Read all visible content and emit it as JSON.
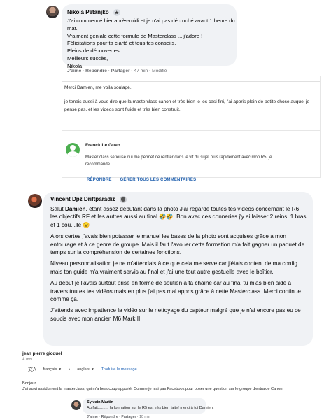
{
  "comment1": {
    "author": "Nikola Petanjko",
    "lines": [
      "J'ai commencé hier après-midi et je n'ai pas décroché avant 1 heure du mat.",
      "Vraiment géniale cette formule de Masterclass ... j'adore !",
      "Félicitations pour ta clarté et tous tes conseils.",
      "Pleins de découvertes.",
      "Meilleurs succès,",
      "Nikola"
    ],
    "like": "J'aime",
    "reply": "Répondre",
    "share": "Partager",
    "time": "47 min",
    "edited": "Modifié"
  },
  "reply_box": {
    "line1": "Merci Damien, me voila soulagé.",
    "para2": "je tenais aussi à vous dire que la masterclass canon et très bien je les casi fini, j'ai appris plein de petite chose auquel je pensé pas, et les videos sont fluide et très bien construit.",
    "sub_author": "Franck Le Guen",
    "sub_text": "Master class sérieuse qui me permet de rentrer dans le vif du sujet plus rapidement avec mon R5, je recommande.",
    "link_reply": "RÉPONDRE",
    "link_manage": "GÉRER TOUS LES COMMENTAIRES"
  },
  "comment2": {
    "author": "Vincent Dpz Driftparadiz",
    "p1_start": "Salut ",
    "p1_name": "Damien",
    "p1_rest": ", étant assez débutant dans la photo J'ai regardé toutes tes vidéos concernant le R6, les objectifs RF et les autres aussi au final 🤣🤣. Bon avec ces conneries j'y ai laisser 2 reins, 1 bras et 1 cou...lle 😉",
    "p2": "Alors certes j'avais bien potasser le manuel les bases de la photo sont acquises grâce a mon entourage et à ce genre de groupe. Mais il faut l'avouer cette formation m'a fait gagner un paquet de temps sur la compréhension de certaines fonctions.",
    "p3": "Niveau personnalisation je ne m'attendais à ce que cela me serve car j'étais content de ma config mais ton guide m'a vraiment servis au final et j'ai une tout autre gestuelle avec le boîtier.",
    "p4": "Au début je l'avais surtout prise en forme de soutien à ta chaîne car au final tu m'as bien aidé à travers toutes tes vidéos mais en plus j'ai pas mal appris grâce à cette Masterclass. Merci continue comme ça.",
    "p5": "J'attends avec impatience la vidéo sur le nettoyage du capteur malgré que je n'ai encore pas eu ce soucis avec mon ancien M6 Mark II."
  },
  "comment3": {
    "author": "jean pierre gicquel",
    "time": "À moi",
    "lang_from": "français",
    "lang_to": "anglais",
    "translate": "Traduire le message",
    "text_hello": "Bonjour",
    "text_body": "J'ai suivi assidument la masterclass, qui m'a beaucoup apporté. Comme je n'ai pas Facebook pour poser une question sur le groupe d'entraide Canon."
  },
  "reply3": {
    "author": "Sylvain Martin",
    "text": "Au fait.......... la formation sur le R5 est très bien faite! merci à toi Damien.",
    "like": "J'aime",
    "reply": "Répondre",
    "share": "Partager",
    "time": "10 min"
  },
  "icons": {
    "translate": "translate-icon",
    "badge": "top-fan-badge-icon"
  }
}
